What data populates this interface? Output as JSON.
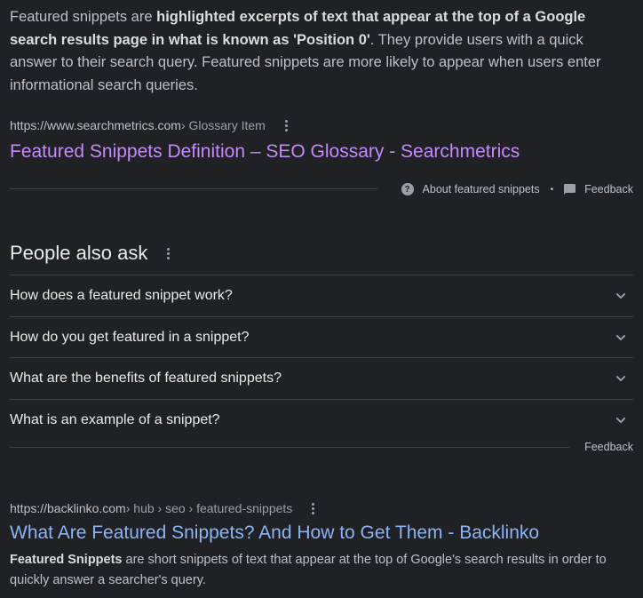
{
  "featured_snippet": {
    "text_part1": "Featured snippets are ",
    "text_bold": "highlighted excerpts of text that appear at the top of a Google search results page in what is known as 'Position 0'",
    "text_part2": ". They provide users with a quick answer to their search query. Featured snippets are more likely to appear when users enter informational search queries.",
    "source_domain": "https://www.searchmetrics.com",
    "source_path": " › Glossary Item",
    "title": "Featured Snippets Definition – SEO Glossary - Searchmetrics",
    "about_label": "About featured snippets",
    "bullet": "•",
    "feedback_label": "Feedback"
  },
  "people_also_ask": {
    "heading": "People also ask",
    "questions": [
      "How does a featured snippet work?",
      "How do you get featured in a snippet?",
      "What are the benefits of featured snippets?",
      "What is an example of a snippet?"
    ],
    "feedback_label": "Feedback"
  },
  "result": {
    "domain": "https://backlinko.com",
    "path": " › hub › seo › featured-snippets",
    "title": "What Are Featured Snippets? And How to Get Them - Backlinko",
    "desc_bold": "Featured Snippets",
    "desc_rest": " are short snippets of text that appear at the top of Google's search results in order to quickly answer a searcher's query."
  },
  "colors": {
    "background": "#202124",
    "visited_link": "#c58af9",
    "link": "#8ab4f8",
    "text": "#bdc1c6"
  },
  "icons": [
    "kebab-menu-icon",
    "help-circle-icon",
    "feedback-icon",
    "chevron-down-icon"
  ]
}
